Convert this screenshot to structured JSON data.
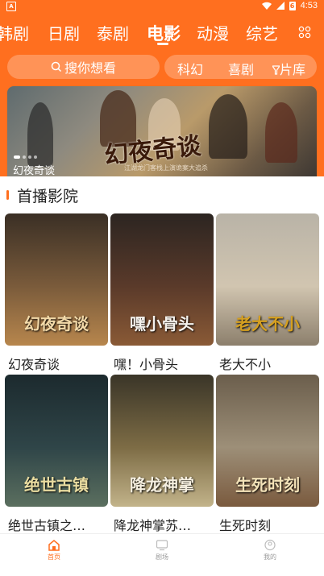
{
  "status_bar": {
    "left_icon": "A",
    "time": "4:53",
    "battery": "6"
  },
  "categories": [
    "韩剧",
    "日剧",
    "泰剧",
    "电影",
    "动漫",
    "综艺"
  ],
  "active_category": "电影",
  "search": {
    "label": "搜你想看"
  },
  "filters": [
    "科幻",
    "喜剧",
    "片库"
  ],
  "banner": {
    "caption": "幻夜奇谈",
    "art_text": "幻夜奇谈",
    "sub_text": "江湖龙门客栈上演诡案大追杀"
  },
  "section": {
    "title": "首播影院"
  },
  "movies": [
    {
      "title": "幻夜奇谈",
      "art": "幻夜奇谈",
      "bg": [
        "#3a2f25",
        "#7a5b3b",
        "#b7864d"
      ],
      "art_color": "#f2d9a8"
    },
    {
      "title": "嘿！小骨头",
      "art": "嘿小骨头",
      "bg": [
        "#2c2521",
        "#5a3a2a",
        "#8a5a36"
      ],
      "art_color": "#f4f1ec"
    },
    {
      "title": "老大不小",
      "art": "老大不小",
      "bg": [
        "#b9b3a7",
        "#d1c5b0",
        "#8c7f6c"
      ],
      "art_color": "#d6a020"
    },
    {
      "title": "绝世古镇之…",
      "art": "绝世古镇",
      "bg": [
        "#1c2a2e",
        "#2f4548",
        "#5b6f5f"
      ],
      "art_color": "#e9dca0"
    },
    {
      "title": "降龙神掌苏…",
      "art": "降龙神掌",
      "bg": [
        "#3a3528",
        "#7d6c45",
        "#c2b38a"
      ],
      "art_color": "#f5efe0"
    },
    {
      "title": "生死时刻",
      "art": "生死时刻",
      "bg": [
        "#6b5e4c",
        "#9d8f78",
        "#7a5a3e"
      ],
      "art_color": "#f3e2b8"
    }
  ],
  "bottom_nav": [
    {
      "label": "首页",
      "icon": "home-icon",
      "active": true
    },
    {
      "label": "剧场",
      "icon": "tv-icon",
      "active": false
    },
    {
      "label": "我的",
      "icon": "profile-icon",
      "active": false
    }
  ],
  "colors": {
    "accent": "#ff6f1f",
    "nav_inactive": "#999999"
  }
}
